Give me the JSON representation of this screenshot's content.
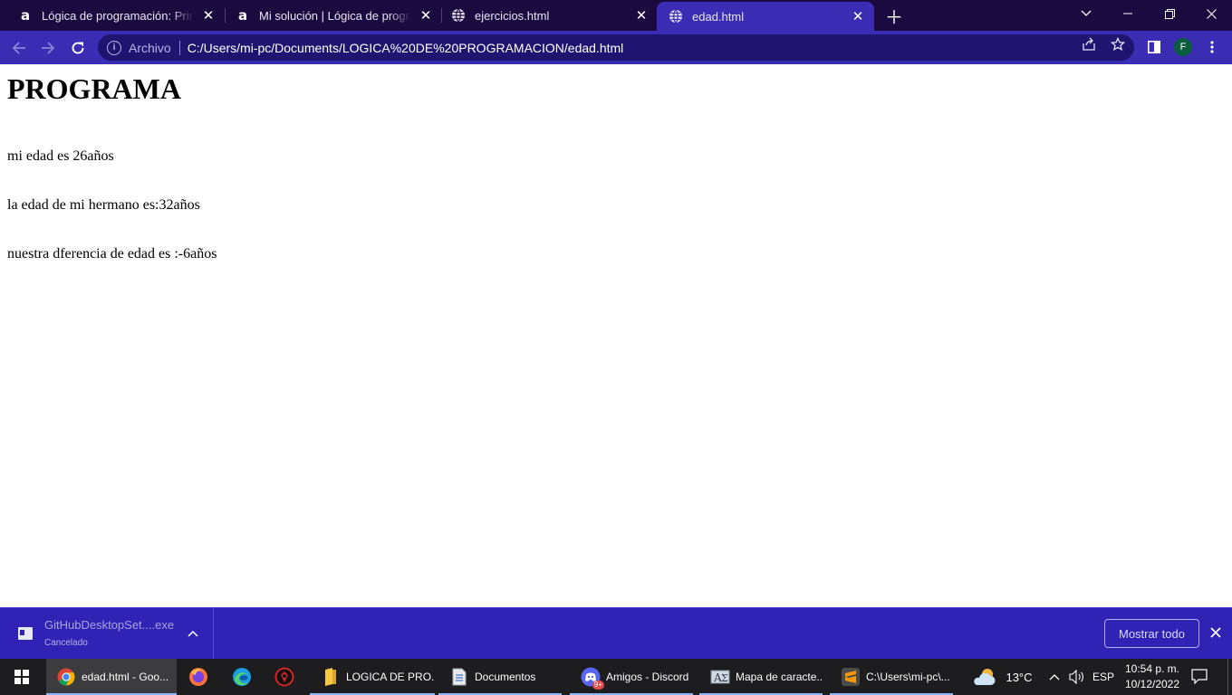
{
  "browser": {
    "tabs": [
      {
        "title": "Lógica de programación: Primeros pasos",
        "favicon": "alura-icon",
        "active": false
      },
      {
        "title": "Mi solución | Lógica de programación",
        "favicon": "alura-icon",
        "active": false
      },
      {
        "title": "ejercicios.html",
        "favicon": "globe-icon",
        "active": false
      },
      {
        "title": "edad.html",
        "favicon": "globe-icon",
        "active": true
      }
    ],
    "address_bar": {
      "security_chip": "Archivo",
      "url": "C:/Users/mi-pc/Documents/LOGICA%20DE%20PROGRAMACION/edad.html"
    },
    "profile_initial": "F",
    "colors": {
      "tabstrip": "#1b0a3f",
      "toolbar": "#3a2db3",
      "omnibox": "#1f1570"
    }
  },
  "page": {
    "heading": "PROGRAMA",
    "lines": [
      "mi edad es 26años",
      "la edad de mi hermano es:32años",
      "nuestra dferencia de edad es :-6años"
    ]
  },
  "download_shelf": {
    "file_name": "GitHubDesktopSet....exe",
    "status": "Cancelado",
    "show_all_label": "Mostrar todo"
  },
  "taskbar": {
    "apps": [
      {
        "label": "edad.html - Goo...",
        "icon": "chrome-icon"
      },
      {
        "label": "",
        "icon": "firefox-icon"
      },
      {
        "label": "",
        "icon": "edge-icon"
      },
      {
        "label": "",
        "icon": "antivirus-icon"
      },
      {
        "label": "LOGICA DE PRO...",
        "icon": "folder-icon"
      },
      {
        "label": "Documentos",
        "icon": "document-icon"
      },
      {
        "label": "Amigos - Discord",
        "icon": "discord-icon",
        "badge": "9+"
      },
      {
        "label": "Mapa de caracte...",
        "icon": "character-map-icon"
      },
      {
        "label": "C:\\Users\\mi-pc\\...",
        "icon": "sublime-text-icon"
      }
    ],
    "weather": {
      "temperature": "13°C",
      "icon": "partly-cloudy-icon"
    },
    "language": "ESP",
    "time": "10:54 p. m.",
    "date": "10/12/2022"
  }
}
